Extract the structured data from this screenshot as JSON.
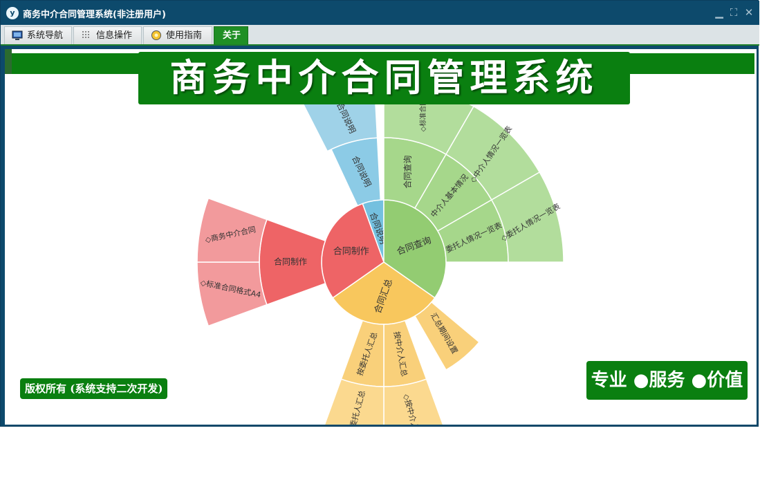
{
  "window": {
    "title": "商务中介合同管理系统(非注册用户)",
    "app_icon": "y",
    "controls": {
      "minimize": "▁",
      "restore": "⛶",
      "close": "✕"
    }
  },
  "menu": {
    "tabs": [
      {
        "label": "系统导航",
        "icon": "monitor-icon"
      },
      {
        "label": "信息操作",
        "icon": "grid-icon"
      },
      {
        "label": "使用指南",
        "icon": "guide-icon"
      },
      {
        "label": "关于",
        "icon": ""
      }
    ],
    "active_tab": 3
  },
  "banner": {
    "title": "商务中介合同管理系统"
  },
  "footer": {
    "copyright": "版权所有 (系统支持二次开发)",
    "slogan": "专业 ●服务 ●价值"
  },
  "colors": {
    "brand_green": "#0a7f10",
    "titlebar": "#0d4a6c",
    "blue": "#74c0df",
    "green": "#93cc72",
    "yellow": "#f8c75d",
    "red": "#ee6466"
  },
  "sunburst": {
    "center_labels": [
      "合同说明",
      "合同查询",
      "合同汇总",
      "合同制作"
    ],
    "level2_labels": [
      "合同说明",
      "合同查询",
      "中介人基本情况",
      "委托人情况一览表",
      "汇总期间设置",
      "按中介人汇总",
      "按委托人汇总",
      "合同制作"
    ],
    "level3_labels": [
      "◇合同说明",
      "◇标准合同",
      "◇中介人情况一览表",
      "◇委托人情况一览表",
      "◇按中介人",
      "◇委托人汇总",
      "◇标准合同格式A4",
      "◇商务中介合同"
    ]
  }
}
